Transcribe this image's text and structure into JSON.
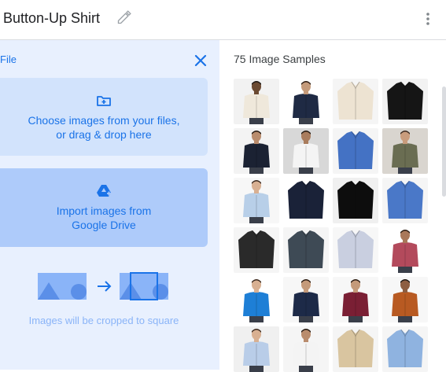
{
  "header": {
    "title": "Button-Up Shirt"
  },
  "panel": {
    "title": "File",
    "upload_line1": "Choose images from your files,",
    "upload_line2": "or drag & drop here",
    "drive_line1": "Import images from",
    "drive_line2": "Google Drive",
    "crop_note": "Images will be cropped to square"
  },
  "samples": {
    "title": "75 Image Samples",
    "items": [
      {
        "bg": "#f2f2f2",
        "shirt": "#efe8db",
        "skin": "#6b4a32",
        "hair": "#1f1a17"
      },
      {
        "bg": "#ffffff",
        "shirt": "#1f2a44",
        "skin": "#c49a7a",
        "hair": "#2b1d14"
      },
      {
        "bg": "#f5f5f5",
        "shirt": "#ede3d2",
        "skin": "",
        "hair": ""
      },
      {
        "bg": "#f2f2f2",
        "shirt": "#151515",
        "skin": "",
        "hair": ""
      },
      {
        "bg": "#f3f3f3",
        "shirt": "#1b2233",
        "skin": "#b98c6d",
        "hair": "#231912"
      },
      {
        "bg": "#d8d8d8",
        "shirt": "#f4f4f4",
        "skin": "#a97c5d",
        "hair": "#231912"
      },
      {
        "bg": "#f5f5f5",
        "shirt": "#4472c4",
        "skin": "",
        "hair": ""
      },
      {
        "bg": "#d9d5cf",
        "shirt": "#6a6d52",
        "skin": "#c99c7c",
        "hair": "#3a2a20"
      },
      {
        "bg": "#f7f7f7",
        "shirt": "#b8cfe8",
        "skin": "#d8b092",
        "hair": "#3a2a20"
      },
      {
        "bg": "#ffffff",
        "shirt": "#1a2238",
        "skin": "",
        "hair": ""
      },
      {
        "bg": "#f0f0f0",
        "shirt": "#0d0d0d",
        "skin": "",
        "hair": ""
      },
      {
        "bg": "#f5f5f5",
        "shirt": "#4a78c8",
        "skin": "",
        "hair": ""
      },
      {
        "bg": "#f5f5f5",
        "shirt": "#2a2a2a",
        "skin": "",
        "hair": ""
      },
      {
        "bg": "#f5f5f5",
        "shirt": "#3e4a55",
        "skin": "",
        "hair": ""
      },
      {
        "bg": "#f7f7f7",
        "shirt": "#c9cfe0",
        "skin": "",
        "hair": ""
      },
      {
        "bg": "#ffffff",
        "shirt": "#b34a5c",
        "skin": "#a9785a",
        "hair": "#2b1d14"
      },
      {
        "bg": "#ffffff",
        "shirt": "#1e7fd6",
        "skin": "#d8b092",
        "hair": "#3a2a20"
      },
      {
        "bg": "#f7f7f7",
        "shirt": "#1d2a48",
        "skin": "#c49a7a",
        "hair": "#2b1d14"
      },
      {
        "bg": "#f7f7f7",
        "shirt": "#7a1f34",
        "skin": "#c49a7a",
        "hair": "#2b1d14"
      },
      {
        "bg": "#f7f7f7",
        "shirt": "#b85a22",
        "skin": "#8d5e42",
        "hair": "#1f1a17"
      },
      {
        "bg": "#f0f0f0",
        "shirt": "#b9cde8",
        "skin": "#d8b092",
        "hair": "#3a2a20"
      },
      {
        "bg": "#f5f5f5",
        "shirt": "#f4f4f4",
        "skin": "#b98c6d",
        "hair": "#231912"
      },
      {
        "bg": "#f5f5f5",
        "shirt": "#d9c5a0",
        "skin": "",
        "hair": ""
      },
      {
        "bg": "#f5f5f5",
        "shirt": "#8fb3e0",
        "skin": "",
        "hair": ""
      }
    ]
  },
  "colors": {
    "accent": "#1a73e8",
    "panel_bg": "#e8f0fe",
    "upload_bg": "#d2e3fc",
    "drive_bg": "#aecbfa"
  }
}
